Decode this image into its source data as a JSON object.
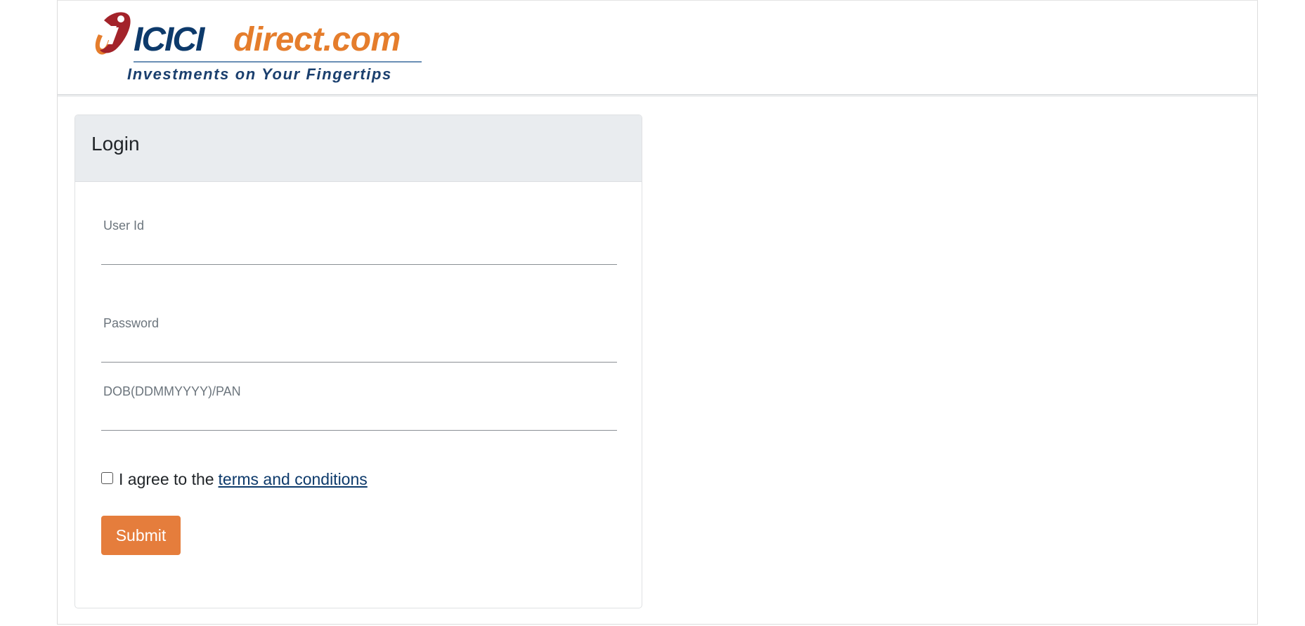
{
  "header": {
    "logo": {
      "brand_primary": "ICICI",
      "brand_secondary": "direct.com",
      "tagline": "Investments on Your Fingertips"
    }
  },
  "login": {
    "title": "Login",
    "fields": {
      "user_id": {
        "label": "User Id",
        "value": ""
      },
      "password": {
        "label": "Password",
        "value": ""
      },
      "dob_pan": {
        "label": "DOB(DDMMYYYY)/PAN",
        "value": ""
      }
    },
    "terms": {
      "prefix": "I agree to the",
      "link_text": "terms and conditions",
      "checked": false
    },
    "submit_label": "Submit"
  },
  "colors": {
    "brand_blue": "#0d3a6b",
    "brand_orange": "#e57d2c",
    "logo_red": "#a3232a",
    "submit_bg": "#e57d3c",
    "card_header_bg": "#e9ecef"
  }
}
